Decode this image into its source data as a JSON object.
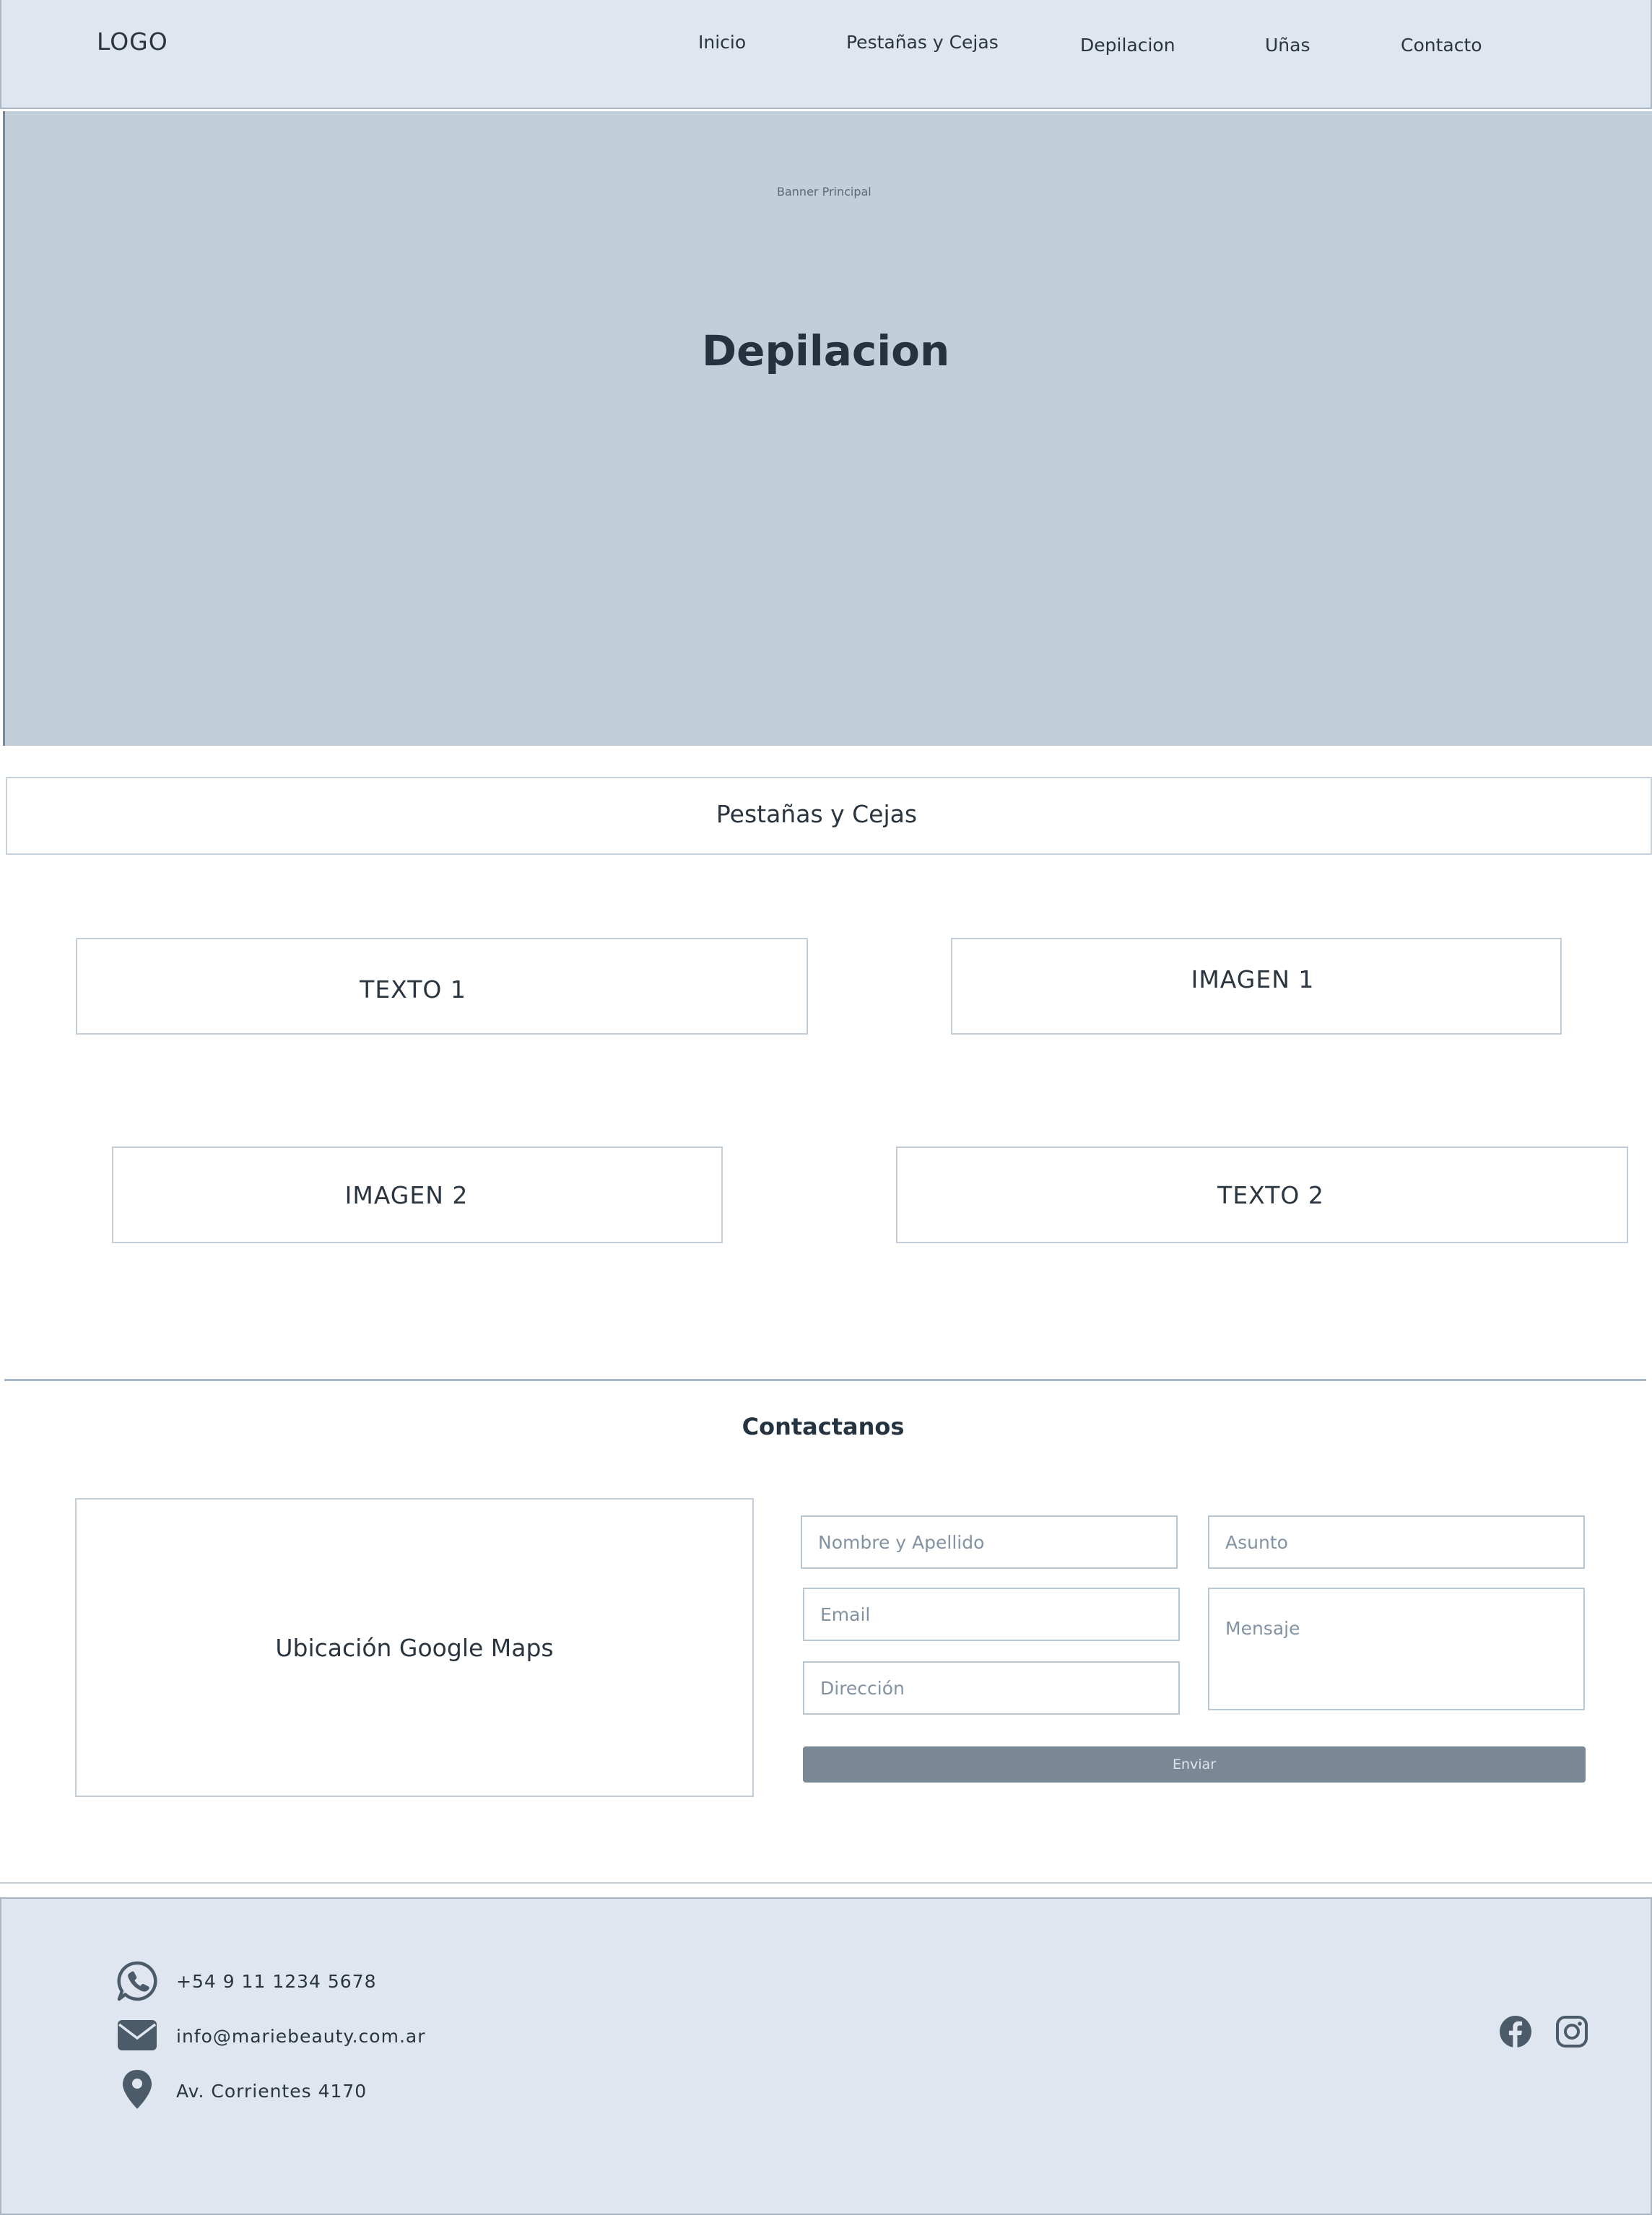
{
  "header": {
    "logo": "LOGO",
    "nav": [
      "Inicio",
      "Pestañas y Cejas",
      "Depilacion",
      "Uñas",
      "Contacto"
    ]
  },
  "banner": {
    "label": "Banner Principal",
    "title": "Depilacion"
  },
  "section": {
    "title": "Pestañas y Cejas",
    "cards": {
      "texto1": "TEXTO 1",
      "imagen1": "IMAGEN 1",
      "imagen2": "IMAGEN 2",
      "texto2": "TEXTO 2"
    }
  },
  "contact": {
    "title": "Contactanos",
    "map_label": "Ubicación Google Maps",
    "form": {
      "name_placeholder": "Nombre y Apellido",
      "subject_placeholder": "Asunto",
      "email_placeholder": "Email",
      "message_placeholder": "Mensaje",
      "address_placeholder": "Dirección",
      "send_label": "Enviar"
    }
  },
  "footer": {
    "phone": "+54 9 11 1234 5678",
    "email": "info@mariebeauty.com.ar",
    "address": "Av. Corrientes 4170",
    "icons": [
      "whatsapp-icon",
      "mail-icon",
      "location-pin-icon",
      "facebook-icon",
      "instagram-icon"
    ]
  },
  "colors": {
    "header_bg": "#dfe6ef",
    "banner_bg": "#c3cfd8",
    "button_bg": "#7a8794",
    "icon_color": "#4b5b69"
  }
}
